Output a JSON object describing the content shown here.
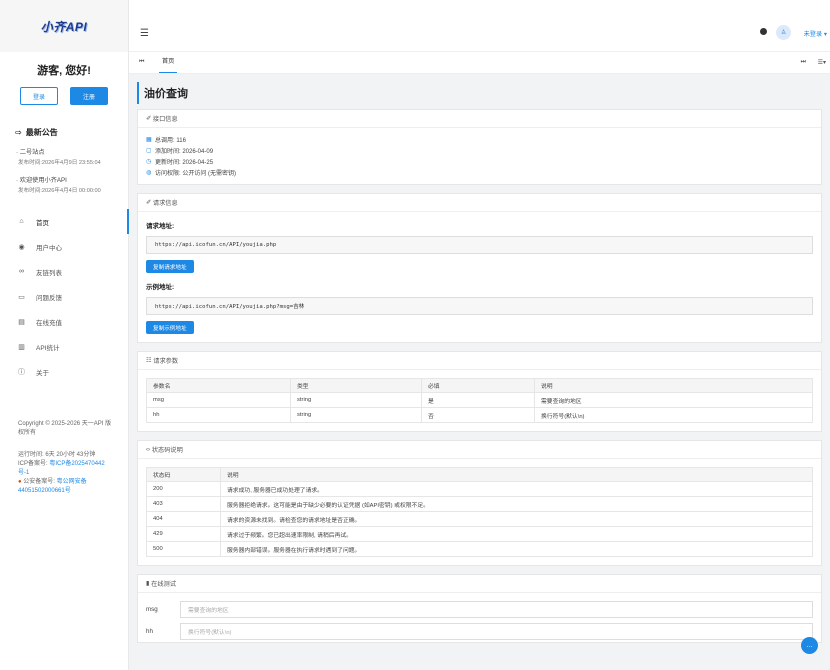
{
  "brand": {
    "logo": "小齐API"
  },
  "sidebar": {
    "greeting": "游客, 您好!",
    "login": "登录",
    "register": "注册",
    "notice_title": "最新公告",
    "notices": [
      {
        "title": "二号站点",
        "time": "发布时间:2026年4月9日 23:55:04"
      },
      {
        "title": "欢迎使用小齐API",
        "time": "发布时间:2026年4月4日 00:00:00"
      }
    ],
    "nav": [
      {
        "label": "首页",
        "icon": "home-icon",
        "glyph": "⌂"
      },
      {
        "label": "用户中心",
        "icon": "user-icon",
        "glyph": "◉"
      },
      {
        "label": "友链列表",
        "icon": "link-icon",
        "glyph": "∞"
      },
      {
        "label": "问题反馈",
        "icon": "message-icon",
        "glyph": "▭"
      },
      {
        "label": "在线充值",
        "icon": "card-icon",
        "glyph": "▤"
      },
      {
        "label": "API统计",
        "icon": "chart-icon",
        "glyph": "▥"
      },
      {
        "label": "关于",
        "icon": "info-icon",
        "glyph": "ⓘ"
      }
    ],
    "copyright": "Copyright © 2025-2026 天一API 版权所有",
    "runtime": "运行时间: 6天 20小时 43分钟",
    "icp_label": "ICP备案号: ",
    "icp": "粤ICP备2025470442号-1",
    "police_label": "公安备案号: ",
    "police": "粤公网安备44051502000661号"
  },
  "header": {
    "user": "未登录"
  },
  "tabs": {
    "home": "首页"
  },
  "page": {
    "title": "油价查询"
  },
  "info_card": {
    "title": "接口信息",
    "rows": [
      {
        "icon": "grid-icon",
        "glyph": "▦",
        "text": "总调用: 116"
      },
      {
        "icon": "calendar-icon",
        "glyph": "▢",
        "text": "添加时间: 2026-04-09"
      },
      {
        "icon": "clock-icon",
        "glyph": "◷",
        "text": "更新时间: 2026-04-25"
      },
      {
        "icon": "key-icon",
        "glyph": "◍",
        "text": "访问权限: 公开访问 (无需密钥)"
      }
    ]
  },
  "request_card": {
    "title": "请求信息",
    "req_label": "请求地址:",
    "req_url": "https://api.icofun.cn/API/youjia.php",
    "copy_req": "复制请求地址",
    "example_label": "示例地址:",
    "example_url": "https://api.icofun.cn/API/youjia.php?msg=吉林",
    "copy_example": "复制示例地址"
  },
  "params_card": {
    "title": "请求参数",
    "headers": [
      "参数名",
      "类型",
      "必填",
      "说明"
    ],
    "rows": [
      [
        "msg",
        "string",
        "是",
        "需要查询的地区"
      ],
      [
        "hh",
        "string",
        "否",
        "换行符号(默认\\n)"
      ]
    ]
  },
  "status_card": {
    "title": "状态码说明",
    "headers": [
      "状态码",
      "说明"
    ],
    "rows": [
      [
        "200",
        "请求成功, 服务器已成功处理了请求。"
      ],
      [
        "403",
        "服务器拒绝请求。这可能是由于缺少必要的认证凭据 (如API密钥) 或权限不足。"
      ],
      [
        "404",
        "请求的资源未找到。请检查您的请求地址是否正确。"
      ],
      [
        "429",
        "请求过于频繁。您已超出速率限制, 请稍后再试。"
      ],
      [
        "500",
        "服务器内部错误。服务器在执行请求时遇到了问题。"
      ]
    ]
  },
  "test_card": {
    "title": "在线测试",
    "fields": [
      {
        "label": "msg",
        "placeholder": "需要查询的地区"
      },
      {
        "label": "hh",
        "placeholder": "换行符号(默认\\n)"
      }
    ]
  }
}
